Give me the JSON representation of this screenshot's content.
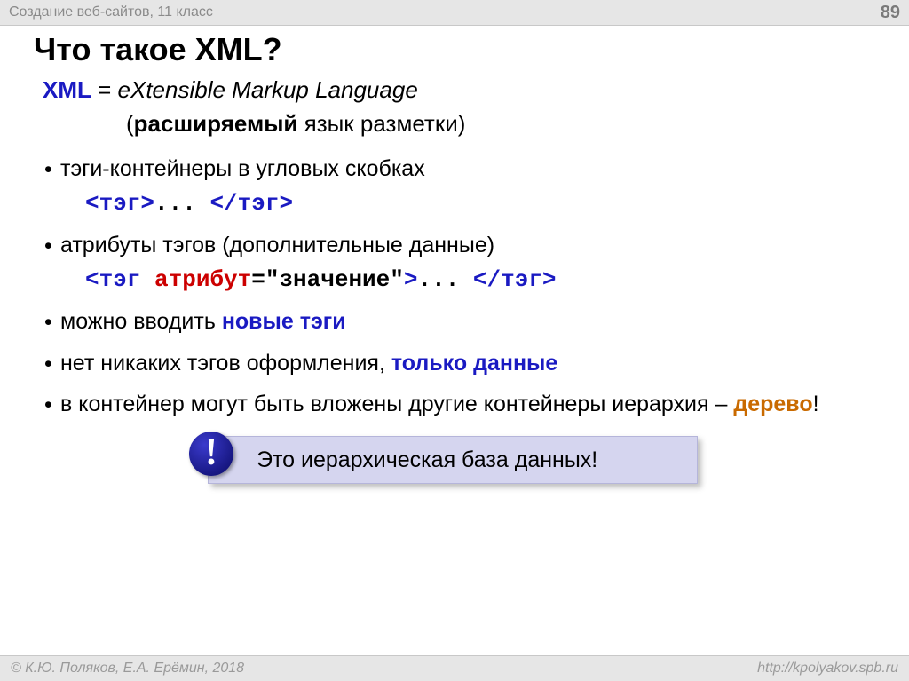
{
  "header": {
    "course": "Создание веб-сайтов, 11 класс",
    "page": "89"
  },
  "title": "Что такое XML?",
  "definition": {
    "xml_word": "XML",
    "eq": " = ",
    "expansion_italic": "eXtensible Markup Language",
    "line2_open": "(",
    "line2_bold": "расширяемый",
    "line2_rest": " язык разметки)"
  },
  "bullets": {
    "b1": "тэги-контейнеры в угловых скобках",
    "code1": {
      "open": "<тэг>",
      "mid": "... ",
      "close": "</тэг>"
    },
    "b2": "атрибуты тэгов (дополнительные данные)",
    "code2": {
      "open": "<тэг ",
      "attr": "атрибут",
      "eq": "=",
      "val": "\"значение\"",
      "gt": ">",
      "mid": "... ",
      "close": "</тэг>"
    },
    "b3_a": "можно вводить ",
    "b3_b": "новые тэги",
    "b4_a": "нет никаких тэгов оформления, ",
    "b4_b": "только данные",
    "b5_a": "в контейнер могут быть вложены другие контейнеры иерархия – ",
    "b5_b": "дерево",
    "b5_c": "!"
  },
  "callout": {
    "mark": "!",
    "text": "Это иерархическая база данных!"
  },
  "footer": {
    "left": "© К.Ю. Поляков, Е.А. Ерёмин, 2018",
    "right": "http://kpolyakov.spb.ru"
  }
}
